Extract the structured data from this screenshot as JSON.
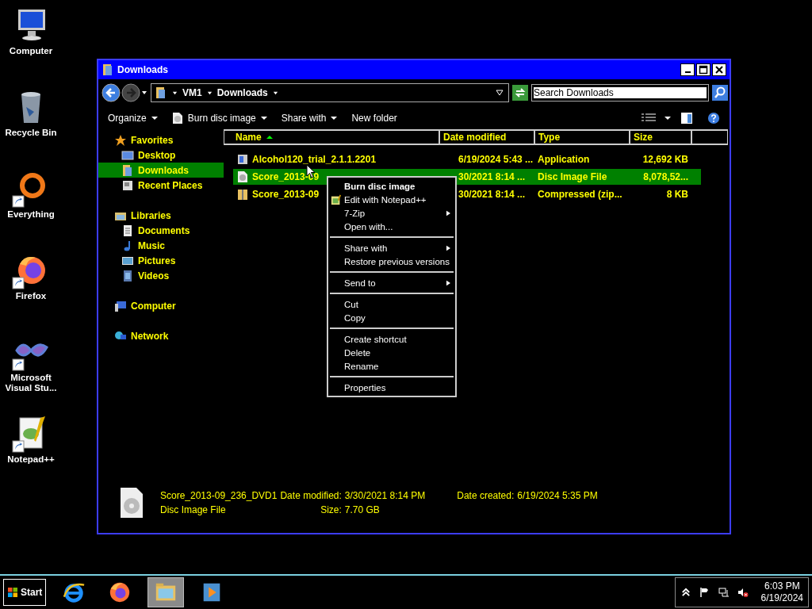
{
  "desktop_icons": [
    {
      "label": "Computer",
      "kind": "computer",
      "shortcut": false
    },
    {
      "label": "Recycle Bin",
      "kind": "recycle",
      "shortcut": false
    },
    {
      "label": "Everything",
      "kind": "everything",
      "shortcut": true
    },
    {
      "label": "Firefox",
      "kind": "firefox",
      "shortcut": true
    },
    {
      "label": "Microsoft Visual Stu...",
      "kind": "vs",
      "shortcut": true
    },
    {
      "label": "Notepad++",
      "kind": "notepad",
      "shortcut": true
    }
  ],
  "window": {
    "title": "Downloads",
    "breadcrumb": [
      "VM1",
      "Downloads"
    ],
    "search": {
      "placeholder": "Search Downloads"
    },
    "toolbar": [
      {
        "label": "Organize",
        "dropdown": true,
        "icon": false
      },
      {
        "label": "Burn disc image",
        "dropdown": true,
        "icon": true
      },
      {
        "label": "Share with",
        "dropdown": true,
        "icon": false
      },
      {
        "label": "New folder",
        "dropdown": false,
        "icon": false
      }
    ],
    "nav": [
      {
        "label": "Favorites",
        "kind": "favorites",
        "selected": false,
        "children": [
          {
            "label": "Desktop",
            "kind": "desktop",
            "selected": false
          },
          {
            "label": "Downloads",
            "kind": "downloads",
            "selected": true
          },
          {
            "label": "Recent Places",
            "kind": "recent",
            "selected": false
          }
        ]
      },
      {
        "label": "Libraries",
        "kind": "libraries",
        "selected": false,
        "children": [
          {
            "label": "Documents",
            "kind": "documents",
            "selected": false
          },
          {
            "label": "Music",
            "kind": "music",
            "selected": false
          },
          {
            "label": "Pictures",
            "kind": "pictures",
            "selected": false
          },
          {
            "label": "Videos",
            "kind": "videos",
            "selected": false
          }
        ]
      },
      {
        "label": "Computer",
        "kind": "computer",
        "selected": false
      },
      {
        "label": "Network",
        "kind": "network",
        "selected": false
      }
    ],
    "columns": [
      {
        "label": "Name",
        "sorted": true
      },
      {
        "label": "Date modified",
        "sorted": false
      },
      {
        "label": "Type",
        "sorted": false
      },
      {
        "label": "Size",
        "sorted": false
      }
    ],
    "rows": [
      {
        "kind": "app",
        "name": "Alcohol120_trial_2.1.1.2201",
        "date": "6/19/2024 5:43 ...",
        "type": "Application",
        "size": "12,692 KB",
        "selected": false
      },
      {
        "kind": "disc",
        "name": "Score_2013-09",
        "date": "30/2021 8:14 ...",
        "type": "Disc Image File",
        "size": "8,078,52...",
        "selected": true
      },
      {
        "kind": "zip",
        "name": "Score_2013-09",
        "date": "30/2021 8:14 ...",
        "type": "Compressed (zip...",
        "size": "8 KB",
        "selected": false
      }
    ],
    "details": {
      "name": "Score_2013-09_236_DVD1",
      "type": "Disc Image File",
      "date_modified_label": "Date modified:",
      "date_modified": "3/30/2021 8:14 PM",
      "size_label": "Size:",
      "size": "7.70 GB",
      "date_created_label": "Date created:",
      "date_created": "6/19/2024 5:35 PM"
    }
  },
  "context_menu": [
    [
      {
        "label": "Burn disc image",
        "bold": true,
        "submenu": false,
        "icon": false
      },
      {
        "label": "Edit with Notepad++",
        "bold": false,
        "submenu": false,
        "icon": true
      },
      {
        "label": "7-Zip",
        "bold": false,
        "submenu": true,
        "icon": false
      },
      {
        "label": "Open with...",
        "bold": false,
        "submenu": false,
        "icon": false
      }
    ],
    [
      {
        "label": "Share with",
        "bold": false,
        "submenu": true,
        "icon": false
      },
      {
        "label": "Restore previous versions",
        "bold": false,
        "submenu": false,
        "icon": false
      }
    ],
    [
      {
        "label": "Send to",
        "bold": false,
        "submenu": true,
        "icon": false
      }
    ],
    [
      {
        "label": "Cut",
        "bold": false,
        "submenu": false,
        "icon": false
      },
      {
        "label": "Copy",
        "bold": false,
        "submenu": false,
        "icon": false
      }
    ],
    [
      {
        "label": "Create shortcut",
        "bold": false,
        "submenu": false,
        "icon": false
      },
      {
        "label": "Delete",
        "bold": false,
        "submenu": false,
        "icon": false
      },
      {
        "label": "Rename",
        "bold": false,
        "submenu": false,
        "icon": false
      }
    ],
    [
      {
        "label": "Properties",
        "bold": false,
        "submenu": false,
        "icon": false
      }
    ]
  ],
  "taskbar": {
    "start": "Start",
    "apps": [
      {
        "kind": "ie",
        "active": false
      },
      {
        "kind": "firefox",
        "active": false
      },
      {
        "kind": "explorer",
        "active": true
      },
      {
        "kind": "media",
        "active": false
      }
    ],
    "time": "6:03 PM",
    "date": "6/19/2024"
  }
}
